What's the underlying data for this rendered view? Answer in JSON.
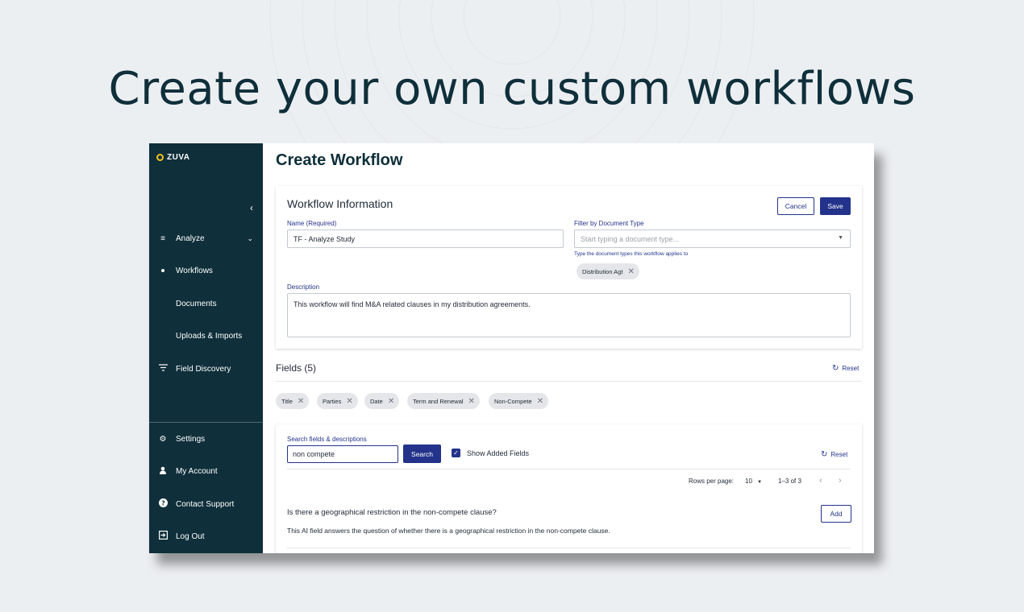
{
  "headline": "Create your own custom workflows",
  "sidebar": {
    "logo": "ZUVA",
    "collapse_icon": "chevron-left",
    "items": [
      {
        "label": "Analyze",
        "icon": "analyze-icon"
      },
      {
        "label": "Workflows",
        "icon": "bullet"
      },
      {
        "label": "Documents"
      },
      {
        "label": "Uploads & Imports"
      },
      {
        "label": "Field Discovery",
        "icon": "filter-icon"
      }
    ],
    "bottom_items": [
      {
        "label": "Settings",
        "icon": "gear-icon"
      },
      {
        "label": "My Account",
        "icon": "person-icon"
      },
      {
        "label": "Contact Support",
        "icon": "help-icon"
      },
      {
        "label": "Log Out",
        "icon": "logout-icon"
      }
    ]
  },
  "page": {
    "title": "Create Workflow"
  },
  "workflow_info": {
    "title": "Workflow Information",
    "cancel_label": "Cancel",
    "save_label": "Save",
    "name_label": "Name (Required)",
    "name_value": "TF - Analyze Study",
    "filter_label": "Filter by Document Type",
    "filter_placeholder": "Start typing a document type...",
    "filter_helper": "Type the document types this workflow applies to",
    "doc_type_chip": "Distribution Agt",
    "description_label": "Description",
    "description_value": "This workflow will find M&A related clauses in my distribution agreements."
  },
  "fields": {
    "title": "Fields (5)",
    "reset_label": "Reset",
    "chips": [
      "Title",
      "Parties",
      "Date",
      "Term and Renewal",
      "Non-Compete"
    ]
  },
  "search": {
    "label": "Search fields & descriptions",
    "value": "non compete",
    "button_label": "Search",
    "show_added_label": "Show Added Fields",
    "show_added_checked": true,
    "reset_label": "Reset",
    "rows_per_page_label": "Rows per page:",
    "rows_per_page_value": "10",
    "range_text": "1–3 of 3"
  },
  "results": [
    {
      "question": "Is there a geographical restriction in the non-compete clause?",
      "description": "This AI field answers the question of whether there is a geographical restriction in the non-compete clause.",
      "add_label": "Add"
    }
  ],
  "colors": {
    "sidebar_bg": "#0f2f3a",
    "accent": "#23338b",
    "logo_ring": "#f2c21b",
    "page_bg": "#eceff2"
  }
}
